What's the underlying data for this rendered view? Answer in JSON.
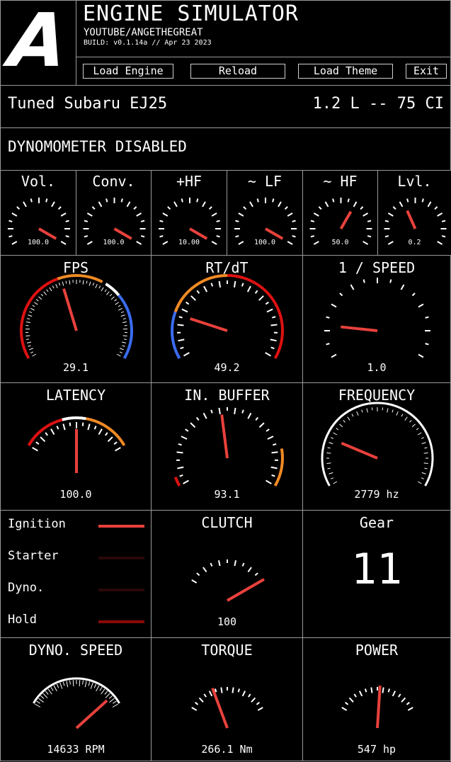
{
  "header": {
    "logo_letter": "A",
    "app_title": "ENGINE SIMULATOR",
    "channel": "YOUTUBE/ANGETHEGREAT",
    "build": "BUILD: v0.1.14a // Apr 23 2023",
    "buttons": {
      "load_engine": "Load Engine",
      "reload": "Reload",
      "load_theme": "Load Theme",
      "exit": "Exit"
    }
  },
  "engine": {
    "name": "Tuned Subaru EJ25",
    "displacement": "1.2 L -- 75 CI"
  },
  "dyno_status": "DYNOMOMETER DISABLED",
  "colors": {
    "needle": "#e8413c",
    "red": "#dd1111",
    "orange": "#f08a24",
    "blue": "#3b6cf0",
    "green": "#2ecc40",
    "border": "#9a9a9a"
  },
  "mixer_gauges": [
    {
      "label": "Vol.",
      "value": "100.0",
      "level": 1.0
    },
    {
      "label": "Conv.",
      "value": "100.0",
      "level": 1.0
    },
    {
      "label": "+HF",
      "value": "10.00",
      "level": 1.0
    },
    {
      "label": "~ LF",
      "value": "100.0",
      "level": 1.0
    },
    {
      "label": "~ HF",
      "value": "50.0",
      "level": 0.5
    },
    {
      "label": "Lvl.",
      "value": "0.2",
      "level": 0.2
    }
  ],
  "gauges": {
    "fps": {
      "label": "FPS",
      "value": "29.1",
      "level": 0.43
    },
    "rtdt": {
      "label": "RT/dT",
      "value": "49.2",
      "level": 0.2
    },
    "speed": {
      "label": "1 / SPEED",
      "value": "1.0",
      "level": 0.15
    },
    "latency": {
      "label": "LATENCY",
      "value": "100.0",
      "level": 0.5
    },
    "buffer": {
      "label": "IN. BUFFER",
      "value": "93.1",
      "level": 0.47
    },
    "frequency": {
      "label": "FREQUENCY",
      "value": "2779 hz",
      "level": 0.22
    },
    "clutch": {
      "label": "CLUTCH",
      "value": "100",
      "level": 1.0
    },
    "dyno_speed": {
      "label": "DYNO. SPEED",
      "value": "14633 RPM",
      "level": 0.9
    },
    "torque": {
      "label": "TORQUE",
      "value": "266.1 Nm",
      "level": 0.33
    },
    "power": {
      "label": "POWER",
      "value": "547 hp",
      "level": 0.53
    }
  },
  "indicators": [
    {
      "label": "Ignition",
      "state": "on",
      "color": "#e8413c"
    },
    {
      "label": "Starter",
      "state": "off",
      "color": "#2a0808"
    },
    {
      "label": "Dyno.",
      "state": "off",
      "color": "#2a0808"
    },
    {
      "label": "Hold",
      "state": "dim",
      "color": "#8a0a0a"
    }
  ],
  "gear": {
    "label": "Gear",
    "value": "11"
  }
}
